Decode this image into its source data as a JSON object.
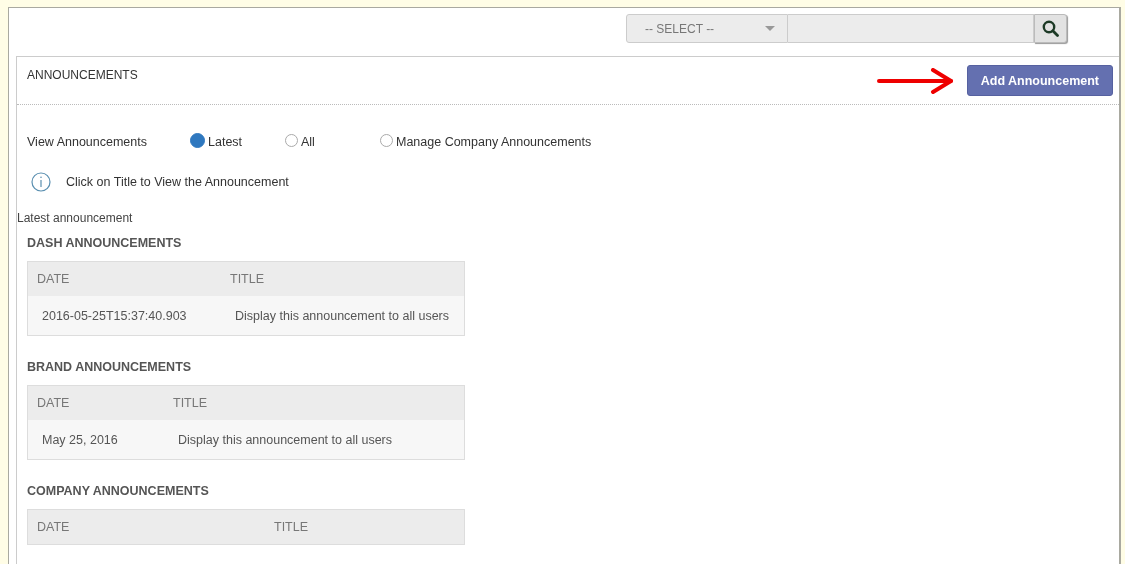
{
  "top_bar": {
    "select": {
      "placeholder": "-- SELECT --"
    }
  },
  "panel": {
    "title": "ANNOUNCEMENTS",
    "add_button": "Add Announcement",
    "view_filter": {
      "label": "View Announcements",
      "options": [
        {
          "label": "Latest",
          "selected": true
        },
        {
          "label": "All",
          "selected": false
        },
        {
          "label": "Manage Company Announcements",
          "selected": false
        }
      ]
    },
    "hint": "Click on Title to View the Announcement",
    "caption": "Latest announcement",
    "sections": [
      {
        "title": "DASH ANNOUNCEMENTS",
        "columns": [
          "DATE",
          "TITLE"
        ],
        "rows": [
          [
            "2016-05-25T15:37:40.903",
            "Display this announcement to all users"
          ]
        ]
      },
      {
        "title": "BRAND ANNOUNCEMENTS",
        "columns": [
          "DATE",
          "TITLE"
        ],
        "rows": [
          [
            "May 25, 2016",
            "Display this announcement to all users"
          ]
        ]
      },
      {
        "title": "COMPANY ANNOUNCEMENTS",
        "columns": [
          "DATE",
          "TITLE"
        ]
      }
    ]
  }
}
